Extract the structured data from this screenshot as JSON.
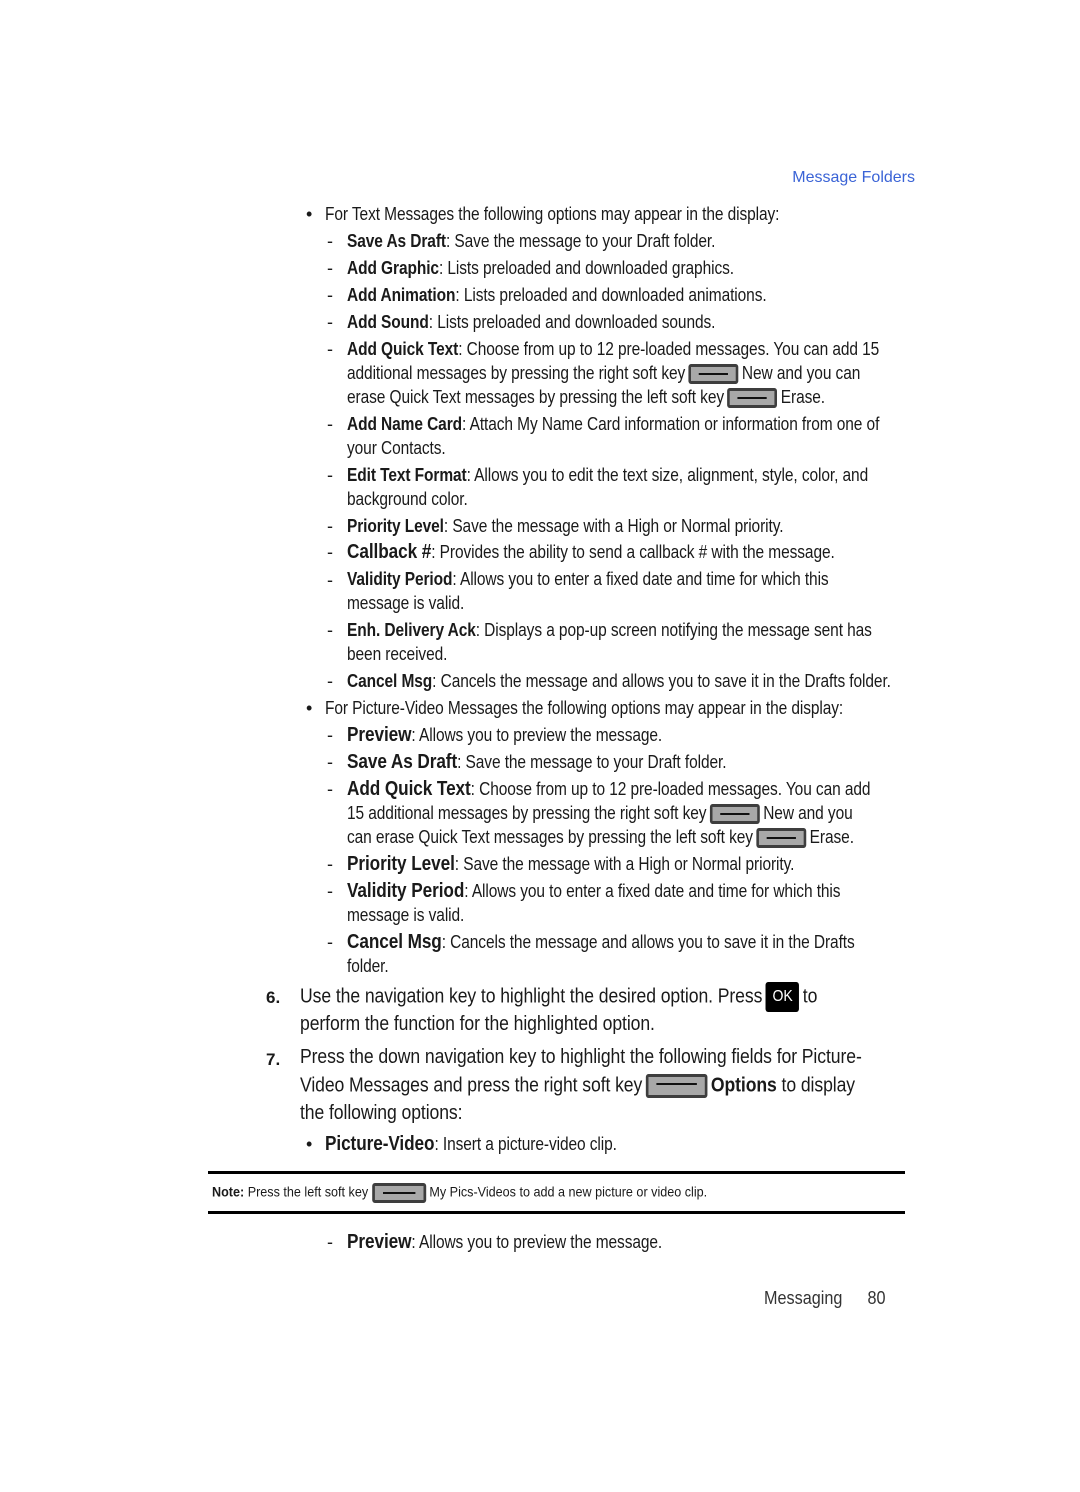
{
  "header": {
    "section_title": "Message Folders"
  },
  "text_messages": {
    "intro": "For Text Messages the following options may appear in the display:",
    "items": [
      {
        "term": "Save As Draft",
        "desc": ": Save the message to your Draft folder."
      },
      {
        "term": "Add Graphic",
        "desc": ": Lists preloaded and downloaded graphics."
      },
      {
        "term": "Add Animation",
        "desc": ": Lists preloaded and downloaded animations."
      },
      {
        "term": "Add Sound",
        "desc": ": Lists preloaded and downloaded sounds."
      },
      {
        "term": "Add Quick Text",
        "desc": ": Choose from up to 12 pre-loaded messages. You can add 15",
        "line2a": "additional messages by pressing the right soft key",
        "line2b": "New and you can",
        "line3a": "erase Quick Text messages by pressing the left soft key",
        "line3b": "Erase."
      },
      {
        "term": "Add Name Card",
        "desc": ": Attach My Name Card information or information from one of",
        "line2": "your Contacts."
      },
      {
        "term": "Edit Text Format",
        "desc": ": Allows you to edit the text size, alignment, style, color, and",
        "line2": "background color."
      },
      {
        "term": "Priority Level",
        "desc": ": Save the message with a High or Normal priority."
      },
      {
        "term": "Callback #",
        "desc": ": Provides the ability to send a callback # with the message."
      },
      {
        "term": "Validity Period",
        "desc": ": Allows you to enter a fixed date and time for which this",
        "line2": "message is valid."
      },
      {
        "term": "Enh. Delivery Ack",
        "desc": ": Displays a pop-up screen notifying the message sent has",
        "line2": "been received."
      },
      {
        "term": "Cancel Msg",
        "desc": ": Cancels the message and allows you to save it in the Drafts folder."
      }
    ]
  },
  "picture_messages": {
    "intro": "For Picture-Video Messages the following options may appear in the display:",
    "items": [
      {
        "term": "Preview",
        "desc": ": Allows you to preview the message."
      },
      {
        "term": "Save As Draft",
        "desc": ": Save the message to your Draft folder."
      },
      {
        "term": "Add Quick Text",
        "desc": ": Choose from up to 12 pre-loaded messages. You can add",
        "line2a": "15 additional messages by pressing the right soft key",
        "line2b": "New and you",
        "line3a": "can erase Quick Text messages by pressing the left soft key",
        "line3b": "Erase."
      },
      {
        "term": "Priority Level",
        "desc": ": Save the message with a High or Normal priority."
      },
      {
        "term": "Validity Period",
        "desc": ": Allows you to enter a fixed date and time for which this",
        "line2": "message is valid."
      },
      {
        "term": "Cancel Msg",
        "desc": ": Cancels the message and allows you to save it in the Drafts",
        "line2": "folder."
      }
    ]
  },
  "steps": [
    {
      "num": "6.",
      "line1a": "Use the navigation key to highlight the desired option. Press",
      "ok_label": "OK",
      "line1b": "to",
      "line2": "perform the function for the highlighted option."
    },
    {
      "num": "7.",
      "line1": "Press the down navigation key to highlight the following fields for Picture-",
      "line2a": "Video Messages and press the right soft key",
      "line2term": "Options",
      "line2b": " to display",
      "line3": "the following options:"
    }
  ],
  "picture_video": {
    "term": "Picture-Video",
    "desc": ": Insert a picture-video clip."
  },
  "note": {
    "label": "Note:",
    "text_a": "Press the left soft key",
    "text_b": "My Pics-Videos to add a new picture or video clip."
  },
  "preview_after": {
    "term": "Preview",
    "desc": ": Allows you to preview the message."
  },
  "footer": {
    "chapter": "Messaging",
    "page": "80"
  },
  "icons": {
    "soft_key": "soft-key-icon",
    "ok_key": "ok-key-icon"
  }
}
